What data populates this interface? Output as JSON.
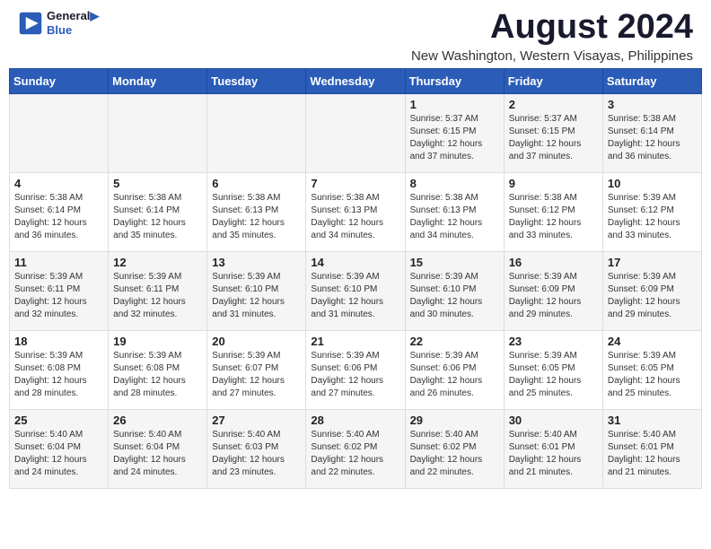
{
  "logo": {
    "line1": "General",
    "line2": "Blue"
  },
  "title": {
    "month_year": "August 2024",
    "location": "New Washington, Western Visayas, Philippines"
  },
  "days_of_week": [
    "Sunday",
    "Monday",
    "Tuesday",
    "Wednesday",
    "Thursday",
    "Friday",
    "Saturday"
  ],
  "weeks": [
    [
      {
        "day": "",
        "info": ""
      },
      {
        "day": "",
        "info": ""
      },
      {
        "day": "",
        "info": ""
      },
      {
        "day": "",
        "info": ""
      },
      {
        "day": "1",
        "info": "Sunrise: 5:37 AM\nSunset: 6:15 PM\nDaylight: 12 hours\nand 37 minutes."
      },
      {
        "day": "2",
        "info": "Sunrise: 5:37 AM\nSunset: 6:15 PM\nDaylight: 12 hours\nand 37 minutes."
      },
      {
        "day": "3",
        "info": "Sunrise: 5:38 AM\nSunset: 6:14 PM\nDaylight: 12 hours\nand 36 minutes."
      }
    ],
    [
      {
        "day": "4",
        "info": "Sunrise: 5:38 AM\nSunset: 6:14 PM\nDaylight: 12 hours\nand 36 minutes."
      },
      {
        "day": "5",
        "info": "Sunrise: 5:38 AM\nSunset: 6:14 PM\nDaylight: 12 hours\nand 35 minutes."
      },
      {
        "day": "6",
        "info": "Sunrise: 5:38 AM\nSunset: 6:13 PM\nDaylight: 12 hours\nand 35 minutes."
      },
      {
        "day": "7",
        "info": "Sunrise: 5:38 AM\nSunset: 6:13 PM\nDaylight: 12 hours\nand 34 minutes."
      },
      {
        "day": "8",
        "info": "Sunrise: 5:38 AM\nSunset: 6:13 PM\nDaylight: 12 hours\nand 34 minutes."
      },
      {
        "day": "9",
        "info": "Sunrise: 5:38 AM\nSunset: 6:12 PM\nDaylight: 12 hours\nand 33 minutes."
      },
      {
        "day": "10",
        "info": "Sunrise: 5:39 AM\nSunset: 6:12 PM\nDaylight: 12 hours\nand 33 minutes."
      }
    ],
    [
      {
        "day": "11",
        "info": "Sunrise: 5:39 AM\nSunset: 6:11 PM\nDaylight: 12 hours\nand 32 minutes."
      },
      {
        "day": "12",
        "info": "Sunrise: 5:39 AM\nSunset: 6:11 PM\nDaylight: 12 hours\nand 32 minutes."
      },
      {
        "day": "13",
        "info": "Sunrise: 5:39 AM\nSunset: 6:10 PM\nDaylight: 12 hours\nand 31 minutes."
      },
      {
        "day": "14",
        "info": "Sunrise: 5:39 AM\nSunset: 6:10 PM\nDaylight: 12 hours\nand 31 minutes."
      },
      {
        "day": "15",
        "info": "Sunrise: 5:39 AM\nSunset: 6:10 PM\nDaylight: 12 hours\nand 30 minutes."
      },
      {
        "day": "16",
        "info": "Sunrise: 5:39 AM\nSunset: 6:09 PM\nDaylight: 12 hours\nand 29 minutes."
      },
      {
        "day": "17",
        "info": "Sunrise: 5:39 AM\nSunset: 6:09 PM\nDaylight: 12 hours\nand 29 minutes."
      }
    ],
    [
      {
        "day": "18",
        "info": "Sunrise: 5:39 AM\nSunset: 6:08 PM\nDaylight: 12 hours\nand 28 minutes."
      },
      {
        "day": "19",
        "info": "Sunrise: 5:39 AM\nSunset: 6:08 PM\nDaylight: 12 hours\nand 28 minutes."
      },
      {
        "day": "20",
        "info": "Sunrise: 5:39 AM\nSunset: 6:07 PM\nDaylight: 12 hours\nand 27 minutes."
      },
      {
        "day": "21",
        "info": "Sunrise: 5:39 AM\nSunset: 6:06 PM\nDaylight: 12 hours\nand 27 minutes."
      },
      {
        "day": "22",
        "info": "Sunrise: 5:39 AM\nSunset: 6:06 PM\nDaylight: 12 hours\nand 26 minutes."
      },
      {
        "day": "23",
        "info": "Sunrise: 5:39 AM\nSunset: 6:05 PM\nDaylight: 12 hours\nand 25 minutes."
      },
      {
        "day": "24",
        "info": "Sunrise: 5:39 AM\nSunset: 6:05 PM\nDaylight: 12 hours\nand 25 minutes."
      }
    ],
    [
      {
        "day": "25",
        "info": "Sunrise: 5:40 AM\nSunset: 6:04 PM\nDaylight: 12 hours\nand 24 minutes."
      },
      {
        "day": "26",
        "info": "Sunrise: 5:40 AM\nSunset: 6:04 PM\nDaylight: 12 hours\nand 24 minutes."
      },
      {
        "day": "27",
        "info": "Sunrise: 5:40 AM\nSunset: 6:03 PM\nDaylight: 12 hours\nand 23 minutes."
      },
      {
        "day": "28",
        "info": "Sunrise: 5:40 AM\nSunset: 6:02 PM\nDaylight: 12 hours\nand 22 minutes."
      },
      {
        "day": "29",
        "info": "Sunrise: 5:40 AM\nSunset: 6:02 PM\nDaylight: 12 hours\nand 22 minutes."
      },
      {
        "day": "30",
        "info": "Sunrise: 5:40 AM\nSunset: 6:01 PM\nDaylight: 12 hours\nand 21 minutes."
      },
      {
        "day": "31",
        "info": "Sunrise: 5:40 AM\nSunset: 6:01 PM\nDaylight: 12 hours\nand 21 minutes."
      }
    ]
  ]
}
